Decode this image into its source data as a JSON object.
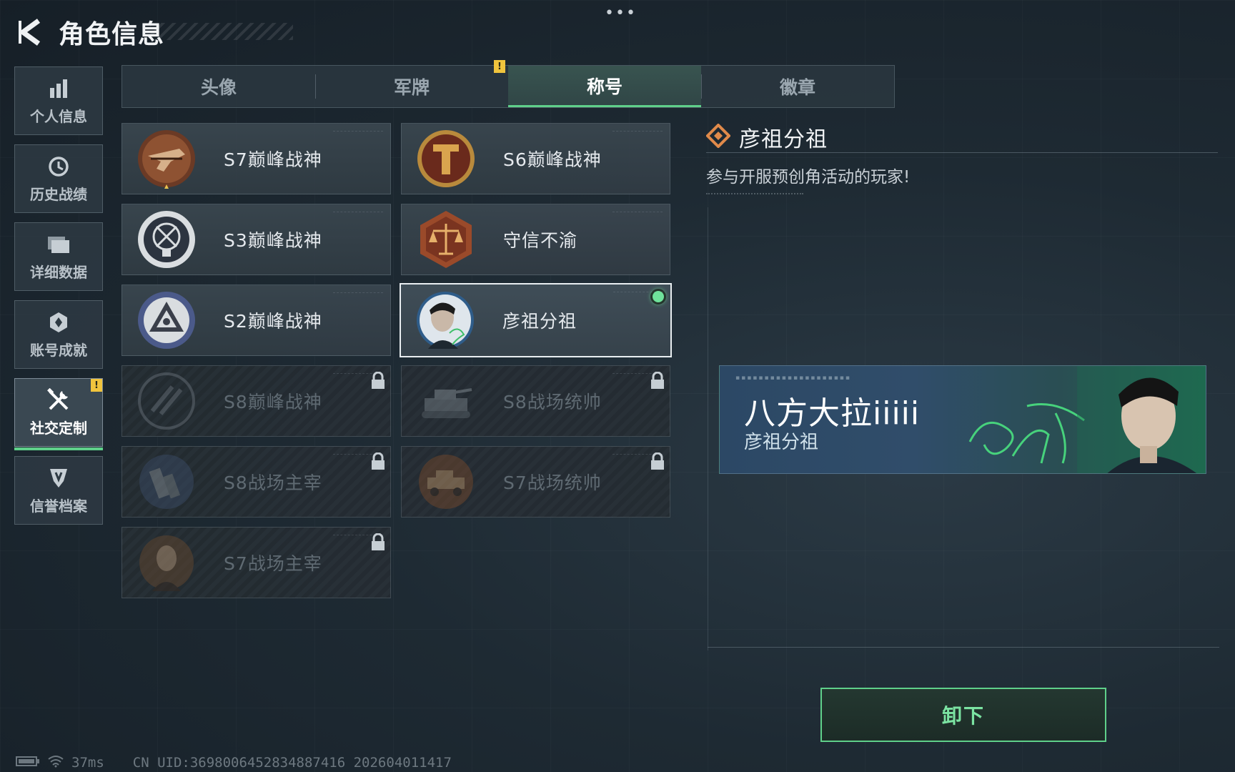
{
  "header": {
    "title": "角色信息",
    "back_icon": "back-arrow-icon"
  },
  "top_menu_icon": "•••",
  "sidebar": {
    "items": [
      {
        "label": "个人信息",
        "icon": "bar-chart-icon",
        "active": false
      },
      {
        "label": "历史战绩",
        "icon": "history-icon",
        "active": false
      },
      {
        "label": "详细数据",
        "icon": "folder-icon",
        "active": false
      },
      {
        "label": "账号成就",
        "icon": "achievement-icon",
        "active": false
      },
      {
        "label": "社交定制",
        "icon": "tools-icon",
        "active": true,
        "badge": "!"
      },
      {
        "label": "信誉档案",
        "icon": "shield-icon",
        "active": false
      }
    ]
  },
  "tabs": [
    {
      "label": "头像",
      "active": false
    },
    {
      "label": "军牌",
      "active": false,
      "badge": "!"
    },
    {
      "label": "称号",
      "active": true
    },
    {
      "label": "徽章",
      "active": false
    }
  ],
  "titles": [
    {
      "label": "S7巅峰战神",
      "emblem": "crossbow-emblem-icon",
      "locked": false
    },
    {
      "label": "S6巅峰战神",
      "emblem": "shield-t-emblem-icon",
      "locked": false
    },
    {
      "label": "S3巅峰战神",
      "emblem": "globe-emblem-icon",
      "locked": false
    },
    {
      "label": "守信不渝",
      "emblem": "scales-emblem-icon",
      "locked": false
    },
    {
      "label": "S2巅峰战神",
      "emblem": "pyramid-emblem-icon",
      "locked": false
    },
    {
      "label": "彦祖分祖",
      "emblem": "portrait-emblem-icon",
      "locked": false,
      "selected": true,
      "equipped": true
    },
    {
      "label": "S8巅峰战神",
      "emblem": "slash-emblem-icon",
      "locked": true
    },
    {
      "label": "S8战场统帅",
      "emblem": "tank-emblem-icon",
      "locked": true
    },
    {
      "label": "S8战场主宰",
      "emblem": "city-emblem-icon",
      "locked": true
    },
    {
      "label": "S7战场统帅",
      "emblem": "vehicle-emblem-icon",
      "locked": true
    },
    {
      "label": "S7战场主宰",
      "emblem": "soldier-emblem-icon",
      "locked": true
    }
  ],
  "detail": {
    "title": "彦祖分祖",
    "description": "参与开服预创角活动的玩家!",
    "nameplate": {
      "player_name": "八方大拉iiiii",
      "title": "彦祖分祖"
    },
    "unequip_label": "卸下"
  },
  "footer": {
    "ping": "37ms",
    "uid": "CN UID:3698006452834887416 202604011417"
  },
  "colors": {
    "accent": "#5fd08a",
    "warning": "#f0c43d",
    "background": "#1e2a33"
  }
}
